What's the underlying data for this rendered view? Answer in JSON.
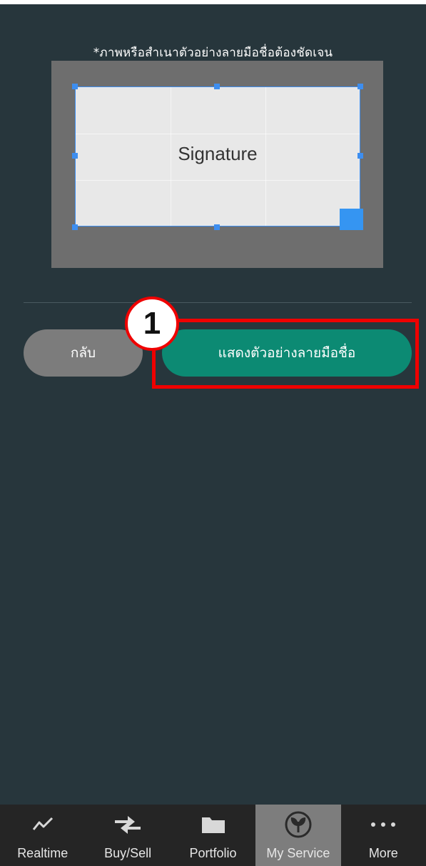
{
  "instruction": "*ภาพหรือสำเนาตัวอย่างลายมือชื่อต้องชัดเจน",
  "signature_placeholder": "Signature",
  "buttons": {
    "back_label": "กลับ",
    "show_label": "แสดงตัวอย่างลายมือชื่อ"
  },
  "annotation": {
    "step_number": "1",
    "highlight_color": "#ef0000"
  },
  "colors": {
    "background": "#27363c",
    "accent_green": "#0c8a73",
    "crop_blue": "#3d8ef0"
  },
  "tabbar": {
    "active_tab": "My Service",
    "tabs": [
      {
        "label": "Realtime",
        "icon": "chart-line-icon"
      },
      {
        "label": "Buy/Sell",
        "icon": "swap-arrows-icon"
      },
      {
        "label": "Portfolio",
        "icon": "folder-icon"
      },
      {
        "label": "My Service",
        "icon": "leaf-logo-icon"
      },
      {
        "label": "More",
        "icon": "more-dots-icon"
      }
    ]
  }
}
